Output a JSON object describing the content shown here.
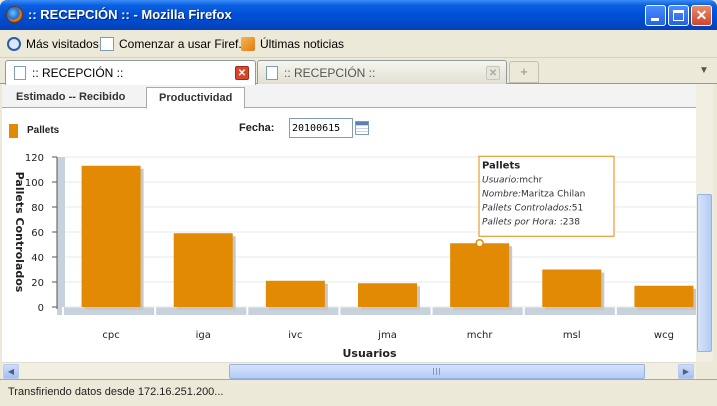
{
  "window": {
    "title": ":: RECEPCIÓN :: - Mozilla Firefox"
  },
  "window_controls": {
    "minimize": "_",
    "maximize": "□",
    "close": "✕"
  },
  "bookmarks": [
    {
      "label": "Más visitados",
      "icon": "search-icon"
    },
    {
      "label": "Comenzar a usar Firef...",
      "icon": "page-icon"
    },
    {
      "label": "Últimas noticias",
      "icon": "rss-icon"
    }
  ],
  "tabs": [
    {
      "label": ":: RECEPCIÓN ::",
      "active": true,
      "close": "✕"
    },
    {
      "label": ":: RECEPCIÓN ::",
      "active": false,
      "close": "✕"
    }
  ],
  "new_tab": "+",
  "tab_list_arrow": "▼",
  "app_tabs": [
    {
      "label": "Estimado -- Recibido",
      "selected": false
    },
    {
      "label": "Productividad",
      "selected": true
    }
  ],
  "legend": {
    "label": "Pallets",
    "color": "#e38a04"
  },
  "fecha": {
    "label": "Fecha:",
    "value": "20100615"
  },
  "chart_data": {
    "type": "bar",
    "categories": [
      "cpc",
      "iga",
      "ivc",
      "jma",
      "mchr",
      "msl",
      "wcg"
    ],
    "series": [
      {
        "name": "Pallets",
        "values": [
          113,
          59,
          21,
          19,
          51,
          30,
          17
        ]
      }
    ],
    "ylabel": "Pallets Controlados",
    "xlabel": "Usuarios",
    "ylim": [
      0,
      120
    ],
    "yticks": [
      0,
      20,
      40,
      60,
      80,
      100,
      120
    ],
    "bar_color": "#e38a04",
    "tooltip": {
      "category_index": 4,
      "title": "Pallets",
      "rows": [
        {
          "key": "Usuario:",
          "value": "mchr"
        },
        {
          "key": "Nombre:",
          "value": "Maritza Chilan"
        },
        {
          "key": "Pallets Controlados:",
          "value": "51"
        },
        {
          "key": "Pallets por Hora:",
          "value": " :238"
        }
      ]
    }
  },
  "scrollbar": {
    "left_arrow": "◀",
    "right_arrow": "▶",
    "up_arrow": "▲",
    "down_arrow": "▼"
  },
  "status": {
    "text": "Transfiriendo datos desde 172.16.251.200..."
  }
}
